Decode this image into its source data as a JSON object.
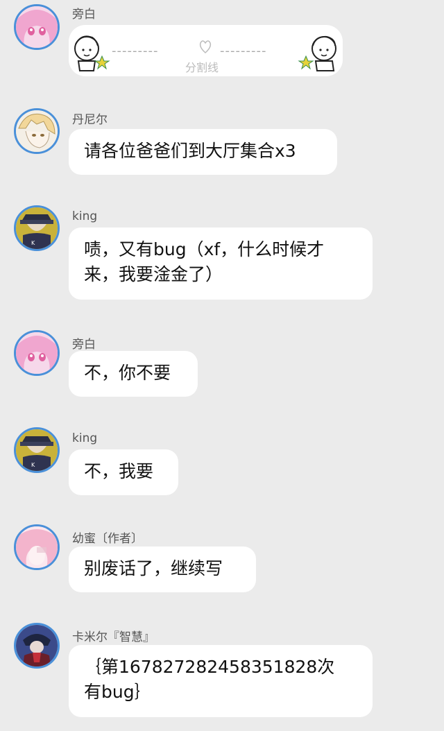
{
  "messages": [
    {
      "sender": "旁白",
      "type": "divider",
      "avatar_icon": "pink-anime-girl-avatar",
      "divider_text": "分割线",
      "dashes_left": "---------",
      "dashes_right": "---------"
    },
    {
      "sender": "丹尼尔",
      "text": "请各位爸爸们到大厅集合x3",
      "avatar_icon": "blonde-sketch-boy-avatar"
    },
    {
      "sender": "king",
      "text_lines": [
        "啧，又有bug（xf，什么时候才",
        "来，我要淦金了）"
      ],
      "avatar_icon": "dark-hat-character-avatar"
    },
    {
      "sender": "旁白",
      "text": "不，你不要",
      "avatar_icon": "pink-anime-girl-avatar"
    },
    {
      "sender": "king",
      "text": "不，我要",
      "avatar_icon": "dark-hat-character-avatar"
    },
    {
      "sender": "幼蜜〔作者〕",
      "text": "别废话了，继续写",
      "avatar_icon": "pink-hair-girl-avatar"
    },
    {
      "sender": "卡米尔『智慧』",
      "text_lines": [
        "｛第16782728245835182​8次",
        "有bug｝"
      ],
      "avatar_icon": "dark-blue-character-avatar"
    }
  ],
  "colors": {
    "background": "#ebebeb",
    "bubble": "#ffffff",
    "avatar_ring": "#4a90d9"
  }
}
